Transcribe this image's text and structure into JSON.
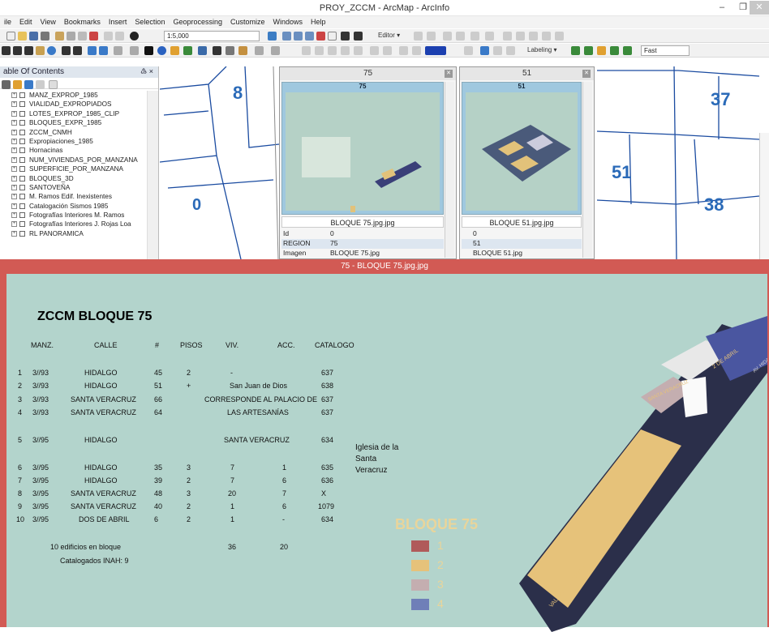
{
  "window": {
    "title": "PROY_ZCCM - ArcMap - ArcInfo",
    "min": "–",
    "max": "❐",
    "close": "✕"
  },
  "menu": [
    "ile",
    "Edit",
    "View",
    "Bookmarks",
    "Insert",
    "Selection",
    "Geoprocessing",
    "Customize",
    "Windows",
    "Help"
  ],
  "toolbar": {
    "scale": "1:5,000",
    "editor": "Editor ▾",
    "labeling": "Labeling ▾",
    "fast": "Fast"
  },
  "toc": {
    "title": "able Of Contents",
    "pin": "♵ ×",
    "layers": [
      "MANZ_EXPROP_1985",
      "VIALIDAD_EXPROPIADOS",
      "LOTES_EXPROP_1985_CLIP",
      "BLOQUES_EXPR_1985",
      "ZCCM_CNMH",
      "Expropiaciones_1985",
      "Hornacinas",
      "NUM_VIVIENDAS_POR_MANZANA",
      "SUPERFICIE_POR_MANZANA",
      "BLOQUES_3D",
      "SANTOVEÑA",
      "M. Ramos Edif. Inexistentes",
      "Catalogación Sismos 1985",
      "Fotografías Interiores M. Ramos",
      "Fotografías Interiores J. Rojas Loa",
      "RL PANORAMICA"
    ]
  },
  "map_left": {
    "nums": [
      "8",
      "0"
    ]
  },
  "map_right": {
    "nums": [
      "37",
      "51",
      "38"
    ]
  },
  "popups": [
    {
      "title": "75",
      "img_header": "75",
      "caption": "BLOQUE 75.jpg.jpg",
      "rows": [
        [
          "Id",
          "0"
        ],
        [
          "REGION",
          "75"
        ],
        [
          "Imagen",
          "BLOQUE 75.jpg"
        ]
      ]
    },
    {
      "title": "51",
      "img_header": "51",
      "caption": "BLOQUE 51.jpg.jpg",
      "rows": [
        [
          "",
          "0"
        ],
        [
          "",
          "51"
        ],
        [
          "",
          "BLOQUE 51.jpg"
        ]
      ]
    }
  ],
  "viewer": {
    "title": "75 - BLOQUE 75.jpg.jpg",
    "doc_title": "ZCCM BLOQUE 75",
    "headers": [
      "MANZ.",
      "CALLE",
      "#",
      "PISOS",
      "VIV.",
      "ACC.",
      "CATALOGO"
    ],
    "rows": [
      [
        "1",
        "3//93",
        "HIDALGO",
        "45",
        "2",
        "-",
        "",
        "637"
      ],
      [
        "2",
        "3//93",
        "HIDALGO",
        "51",
        "+",
        "San Juan de Dios",
        "",
        "638"
      ],
      [
        "3",
        "3//93",
        "SANTA VERACRUZ",
        "66",
        "",
        "CORRESPONDE AL PALACIO DE",
        "",
        "637"
      ],
      [
        "4",
        "3//93",
        "SANTA VERACRUZ",
        "64",
        "",
        "LAS ARTESANÍAS",
        "",
        "637"
      ],
      [
        "5",
        "3//95",
        "HIDALGO",
        "",
        "",
        "SANTA VERACRUZ",
        "",
        "634"
      ],
      [
        "6",
        "3//95",
        "HIDALGO",
        "35",
        "3",
        "7",
        "1",
        "635"
      ],
      [
        "7",
        "3//95",
        "HIDALGO",
        "39",
        "2",
        "7",
        "6",
        "636"
      ],
      [
        "8",
        "3//95",
        "SANTA VERACRUZ",
        "48",
        "3",
        "20",
        "7",
        "X"
      ],
      [
        "9",
        "3//95",
        "SANTA VERACRUZ",
        "40",
        "2",
        "1",
        "6",
        "1079"
      ],
      [
        "10",
        "3//95",
        "DOS DE ABRIL",
        "6",
        "2",
        "1",
        "-",
        "634"
      ]
    ],
    "church": [
      "Iglesia de la",
      "Santa",
      "Veracruz"
    ],
    "foot": {
      "buildings": "10 edificios en bloque",
      "catalogued": "Catalogados INAH: 9",
      "viv_total": "36",
      "acc_total": "20"
    },
    "legend": {
      "title": "BLOQUE 75",
      "items": [
        {
          "num": "1",
          "color": "#b05a5a"
        },
        {
          "num": "2",
          "color": "#e6c27a"
        },
        {
          "num": "3",
          "color": "#c4aeb0"
        },
        {
          "num": "4",
          "color": "#6f7fb8"
        }
      ]
    },
    "street_labels": [
      "VALERIO TRUJANO",
      "2 DE ABRIL",
      "SANTA VERACRUZ",
      "AV. HIDALGO"
    ]
  }
}
